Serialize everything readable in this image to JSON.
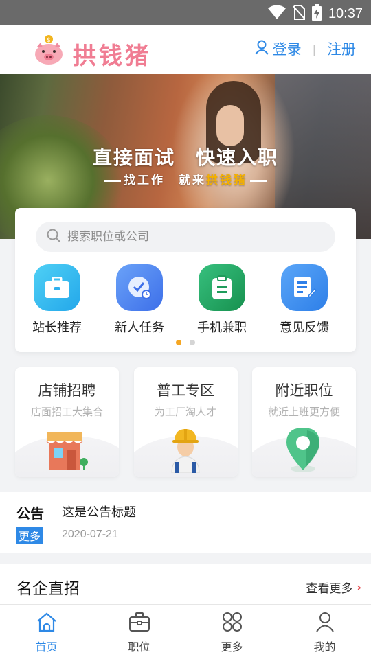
{
  "status_bar": {
    "time": "10:37",
    "icons": [
      "wifi-icon",
      "no-sim-icon",
      "battery-charging-icon"
    ]
  },
  "header": {
    "app_name": "拱钱猪",
    "logo_icon": "piggy-bank-icon",
    "login_label": "登录",
    "separator": "|",
    "register_label": "注册",
    "accent_color": "#2e89e6",
    "brand_color": "#f07d93"
  },
  "banner": {
    "title": "直接面试　快速入职",
    "subtitle_prefix": "找工作　就来",
    "subtitle_highlight": "拱钱猪"
  },
  "search": {
    "placeholder": "搜索职位或公司"
  },
  "quick_links": [
    {
      "label": "站长推荐",
      "icon": "briefcase-icon"
    },
    {
      "label": "新人任务",
      "icon": "clock-check-icon"
    },
    {
      "label": "手机兼职",
      "icon": "clipboard-icon"
    },
    {
      "label": "意见反馈",
      "icon": "edit-note-icon"
    }
  ],
  "pager": {
    "pages": 2,
    "active": 1,
    "active_color": "#f5a623"
  },
  "features": [
    {
      "title": "店铺招聘",
      "subtitle": "店面招工大集合",
      "icon": "storefront-icon"
    },
    {
      "title": "普工专区",
      "subtitle": "为工厂淘人才",
      "icon": "worker-helmet-icon"
    },
    {
      "title": "附近职位",
      "subtitle": "就近上班更方便",
      "icon": "map-pin-icon"
    }
  ],
  "notice": {
    "tag": "公告",
    "more_label": "更多",
    "title": "这是公告标题",
    "date": "2020-07-21"
  },
  "section": {
    "title": "名企直招",
    "more_label": "查看更多",
    "chevron": "›"
  },
  "tabbar": {
    "active": 0,
    "tabs": [
      {
        "label": "首页",
        "icon": "home-icon"
      },
      {
        "label": "职位",
        "icon": "briefcase-icon"
      },
      {
        "label": "更多",
        "icon": "grid-more-icon"
      },
      {
        "label": "我的",
        "icon": "user-icon"
      }
    ]
  }
}
